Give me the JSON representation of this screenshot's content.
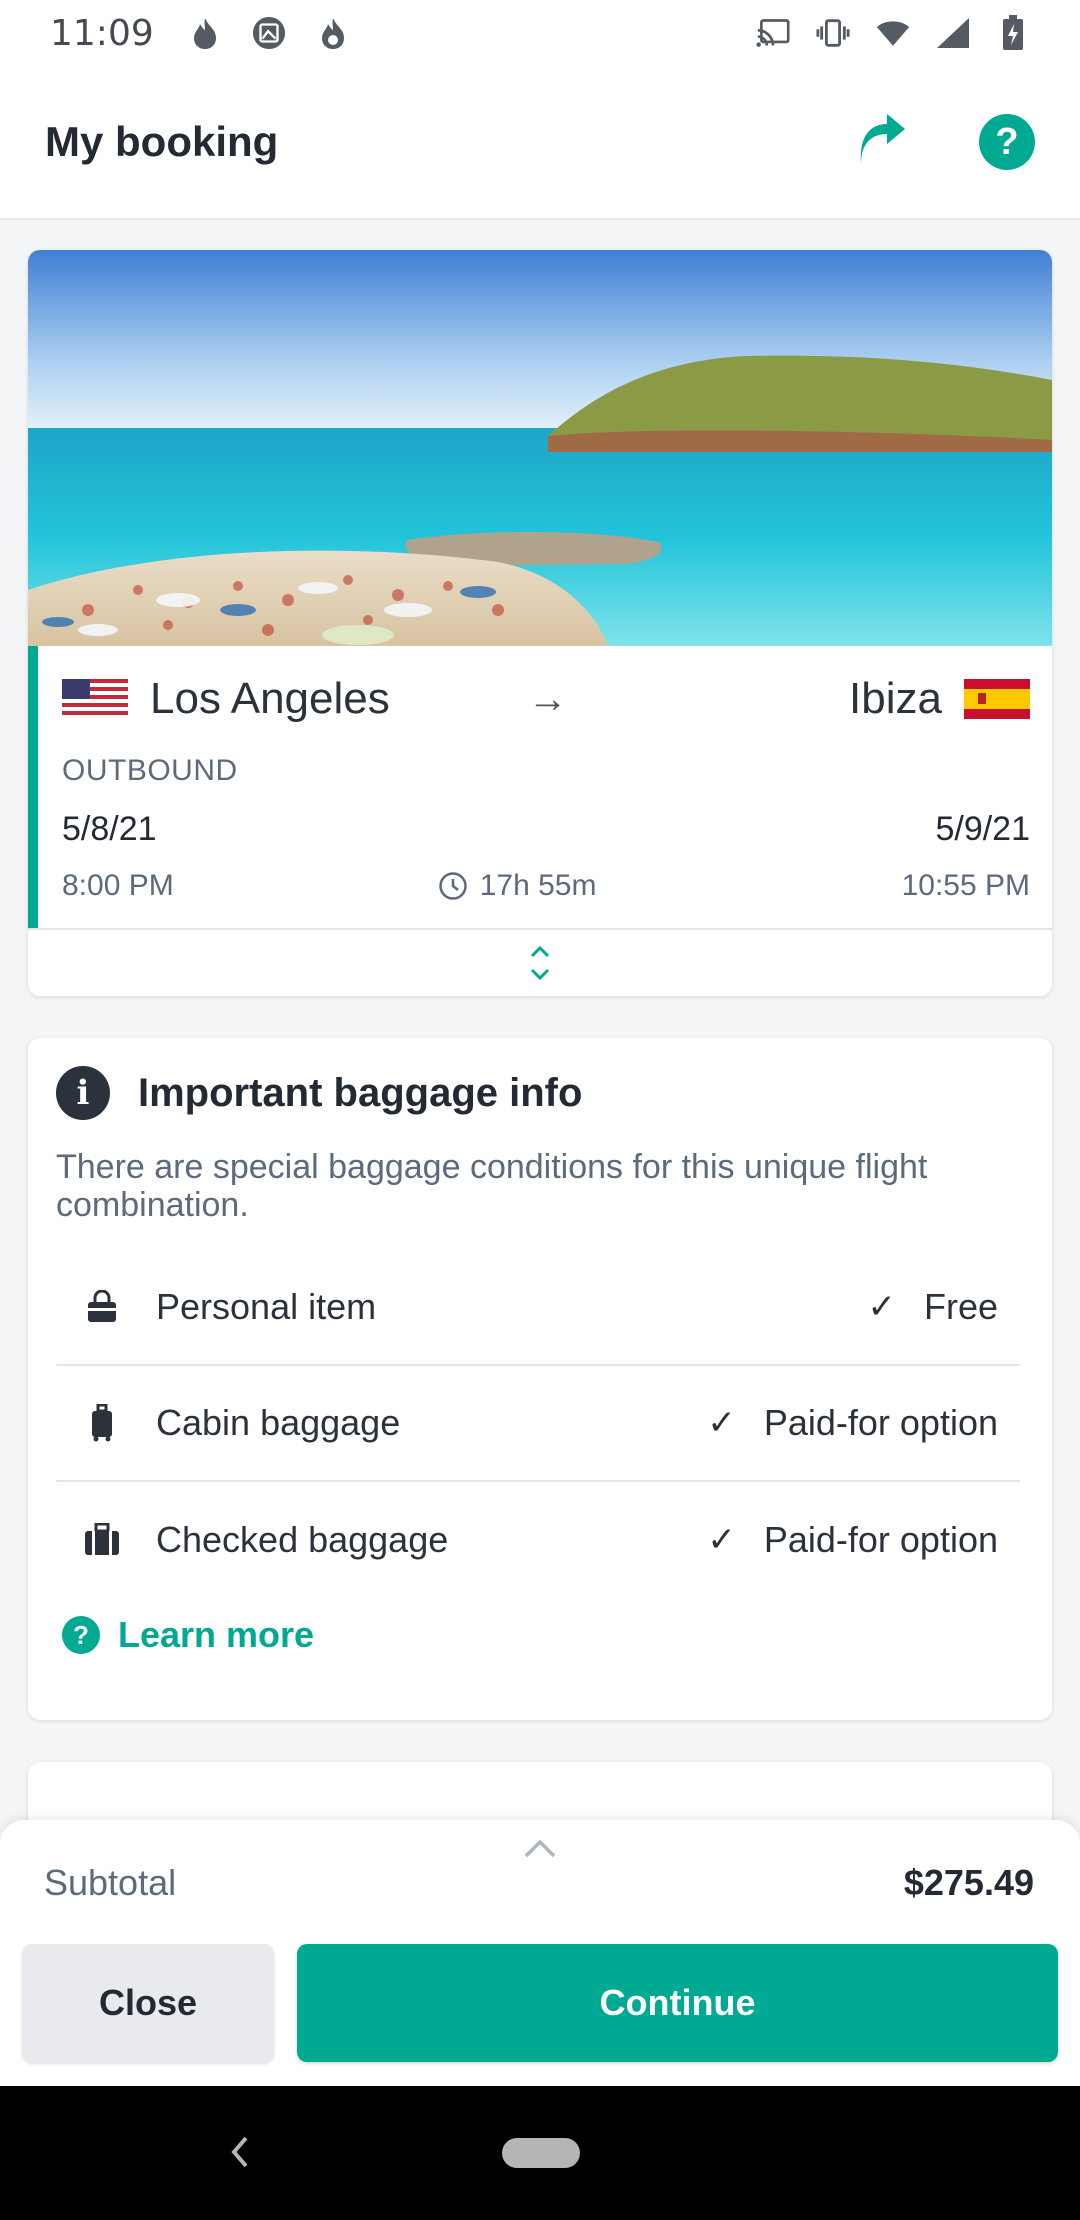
{
  "status_bar": {
    "time": "11:09",
    "left_icons": [
      "flame-icon",
      "image-icon",
      "flame-badge-icon"
    ],
    "right_icons": [
      "cast-icon",
      "vibrate-icon",
      "wifi-icon",
      "signal-icon",
      "battery-charging-icon"
    ]
  },
  "app_bar": {
    "title": "My booking",
    "share_icon": "share-arrow-icon",
    "help_icon": "help-icon",
    "help_glyph": "?"
  },
  "flight": {
    "origin_city": "Los Angeles",
    "origin_flag": "us-flag",
    "destination_city": "Ibiza",
    "destination_flag": "spain-flag",
    "arrow": "→",
    "direction": "OUTBOUND",
    "depart_date": "5/8/21",
    "arrive_date": "5/9/21",
    "depart_time": "8:00 PM",
    "duration": "17h 55m",
    "arrive_time": "10:55 PM"
  },
  "baggage": {
    "info_glyph": "i",
    "title": "Important baggage info",
    "description": "There are special baggage conditions for this unique flight combination.",
    "items": [
      {
        "icon": "handbag-icon",
        "name": "Personal item",
        "check": "✓",
        "status": "Free"
      },
      {
        "icon": "cabin-bag-icon",
        "name": "Cabin baggage",
        "check": "✓",
        "status": "Paid-for option"
      },
      {
        "icon": "suitcase-icon",
        "name": "Checked baggage",
        "check": "✓",
        "status": "Paid-for option"
      }
    ],
    "learn_more_glyph": "?",
    "learn_more": "Learn more"
  },
  "footer": {
    "subtotal_label": "Subtotal",
    "subtotal_value": "$275.49",
    "close_label": "Close",
    "continue_label": "Continue"
  },
  "colors": {
    "accent": "#00a991",
    "text_dark": "#232a33",
    "text_muted": "#5d6a7c"
  }
}
